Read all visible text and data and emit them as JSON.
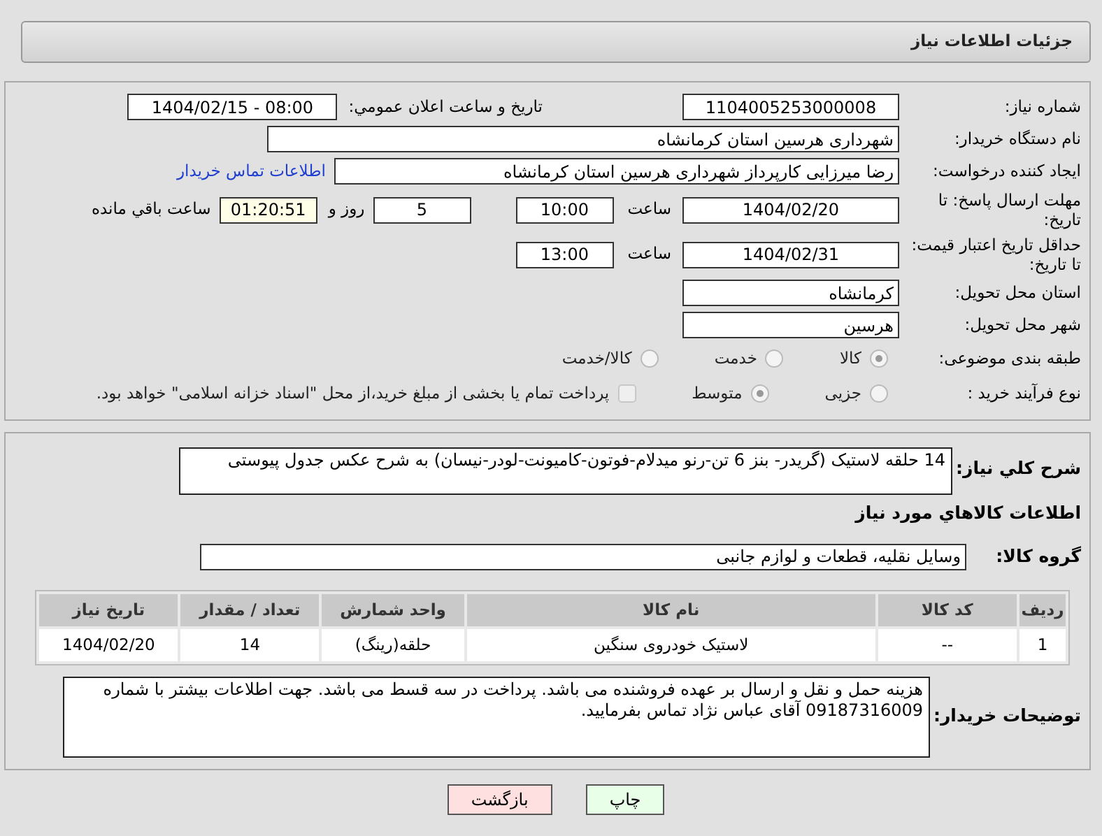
{
  "header": {
    "title": "جزئیات اطلاعات نیاز"
  },
  "general": {
    "need_number": {
      "label": "شماره نیاز:",
      "value": "1104005253000008"
    },
    "announce_datetime": {
      "label": "تاریخ و ساعت اعلان عمومي:",
      "value": "1404/02/15 - 08:00"
    },
    "buyer_org": {
      "label": "نام دستگاه خریدار:",
      "value": "شهرداری هرسین استان کرمانشاه"
    },
    "requester": {
      "label": "ایجاد کننده درخواست:",
      "value": "رضا میرزایی کارپرداز شهرداری هرسین استان کرمانشاه",
      "link": "اطلاعات تماس خریدار"
    },
    "reply_deadline": {
      "label": "مهلت ارسال پاسخ: تا تاریخ:",
      "date": "1404/02/20",
      "time_label": "ساعت",
      "time": "10:00",
      "days": "5",
      "days_label": "روز و",
      "remaining": "01:20:51",
      "remaining_label": "ساعت باقي مانده"
    },
    "price_validity": {
      "label": "حداقل تاریخ اعتبار قیمت: تا تاریخ:",
      "date": "1404/02/31",
      "time_label": "ساعت",
      "time": "13:00"
    },
    "delivery_province": {
      "label": "استان محل تحویل:",
      "value": "کرمانشاه"
    },
    "delivery_city": {
      "label": "شهر محل تحویل:",
      "value": "هرسین"
    },
    "category": {
      "label": "طبقه بندی موضوعی:",
      "options": [
        {
          "label": "کالا",
          "selected": true
        },
        {
          "label": "خدمت",
          "selected": false
        },
        {
          "label": "کالا/خدمت",
          "selected": false
        }
      ]
    },
    "process": {
      "label": "نوع فرآیند خرید :",
      "options": [
        {
          "label": "جزیی",
          "selected": false
        },
        {
          "label": "متوسط",
          "selected": true
        }
      ],
      "treasury": {
        "label": "پرداخت تمام یا بخشی از مبلغ خرید،از محل \"اسناد خزانه اسلامی\" خواهد بود.",
        "checked": false
      }
    }
  },
  "needs": {
    "summary_label": "شرح کلي نياز:",
    "summary": "14 حلقه لاستیک (گریدر- بنز 6 تن-رنو میدلام-فوتون-کامیونت-لودر-نیسان) به شرح عکس جدول پیوستی",
    "items_title": "اطلاعات کالاهاي مورد نياز",
    "group_label": "گروه کالا:",
    "group": "وسایل نقلیه، قطعات و لوازم جانبی",
    "table": {
      "columns": [
        "ردیف",
        "کد کالا",
        "نام کالا",
        "واحد شمارش",
        "تعداد / مقدار",
        "تاریخ نیاز"
      ],
      "rows": [
        [
          "1",
          "--",
          "لاستیک خودروی سنگین",
          "حلقه(رینگ)",
          "14",
          "1404/02/20"
        ]
      ]
    },
    "notes_label": "توضیحات خریدار:",
    "notes": "هزینه حمل و نقل و ارسال بر عهده فروشنده می باشد. پرداخت در سه قسط می باشد. جهت اطلاعات بیشتر با شماره 09187316009 آقای عباس نژاد تماس بفرمایید."
  },
  "buttons": [
    {
      "label": "چاپ",
      "kind": "print"
    },
    {
      "label": "بازگشت",
      "kind": "back"
    }
  ]
}
